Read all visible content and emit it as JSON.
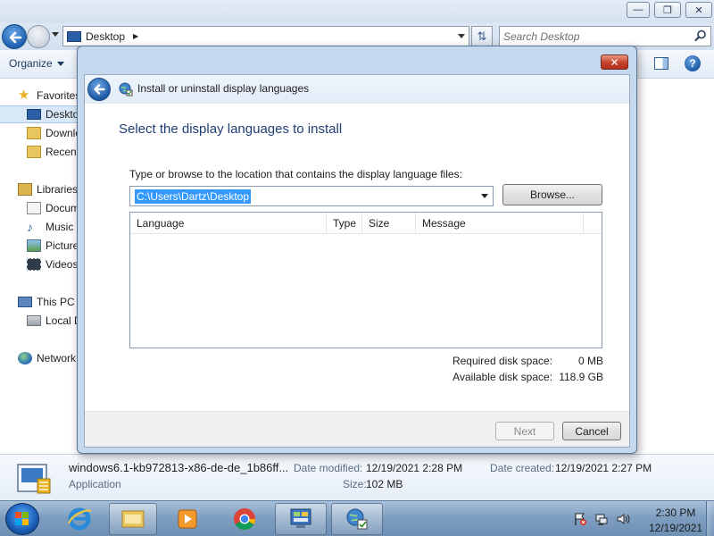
{
  "explorer": {
    "address": {
      "location": "Desktop"
    },
    "search": {
      "placeholder": "Search Desktop"
    },
    "toolbar": {
      "organize_label": "Organize"
    },
    "nav": {
      "favorites": "Favorites",
      "desktop": "Desktop",
      "downloads": "Downloads",
      "recent": "Recent Places",
      "libraries": "Libraries",
      "documents": "Documents",
      "music": "Music",
      "pictures": "Pictures",
      "videos": "Videos",
      "this_pc": "This PC",
      "local_disk": "Local Disk",
      "network": "Network"
    },
    "details": {
      "file_name": "windows6.1-kb972813-x86-de-de_1b86ff...",
      "file_type": "Application",
      "modified_label": "Date modified:",
      "modified_value": "12/19/2021 2:28 PM",
      "size_label": "Size:",
      "size_value": "102 MB",
      "created_label": "Date created:",
      "created_value": "12/19/2021 2:27 PM"
    }
  },
  "dialog": {
    "title": "Install or uninstall display languages",
    "heading": "Select the display languages to install",
    "path_label": "Type or browse to the location that contains the display language files:",
    "path_value": "C:\\Users\\Dartz\\Desktop\\",
    "browse_label": "Browse...",
    "table": {
      "columns": [
        "Language",
        "Type",
        "Size",
        "Message"
      ],
      "rows": []
    },
    "disk": {
      "required_label": "Required disk space:",
      "required_value": "0 MB",
      "available_label": "Available disk space:",
      "available_value": "118.9 GB"
    },
    "next_label": "Next",
    "cancel_label": "Cancel"
  },
  "taskbar": {
    "clock": {
      "time": "2:30 PM",
      "date": "12/19/2021"
    }
  },
  "colors": {
    "accent_heading": "#1f3f74",
    "selection": "#3399ff",
    "close_button": "#c4402a",
    "taskbar": "#7f9fc1"
  }
}
